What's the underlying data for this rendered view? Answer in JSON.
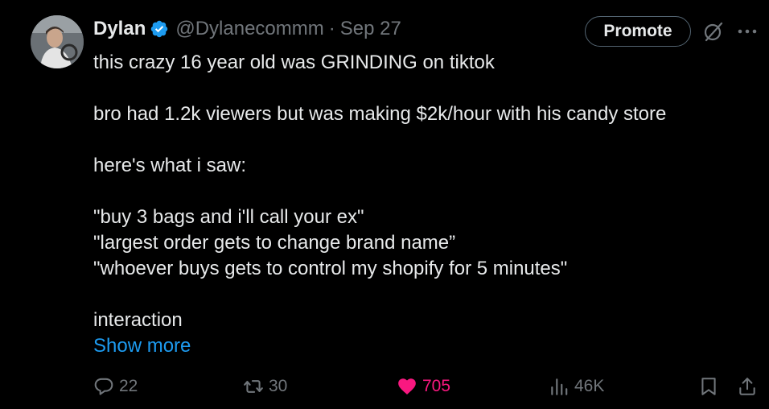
{
  "author": {
    "name": "Dylan",
    "handle": "@Dylanecommm",
    "separator": "·",
    "date": "Sep 27",
    "verified_color": "#1d9bf0"
  },
  "header_actions": {
    "promote_label": "Promote"
  },
  "tweet": {
    "lines": [
      "this crazy 16 year old was GRINDING on tiktok",
      "",
      "bro had 1.2k viewers but was making $2k/hour with his candy store",
      "",
      "here's what i saw:",
      "",
      "\"buy 3 bags and i'll call your ex\"",
      "\"largest order gets to change brand name”",
      "\"whoever buys gets to control my shopify for 5 minutes\"",
      "",
      "interaction"
    ],
    "show_more": "Show more"
  },
  "stats": {
    "replies": "22",
    "reposts": "30",
    "likes": "705",
    "views": "46K"
  },
  "colors": {
    "background": "#000000",
    "text": "#e7e9ea",
    "muted": "#71767b",
    "link": "#1d9bf0",
    "like": "#f91880"
  }
}
